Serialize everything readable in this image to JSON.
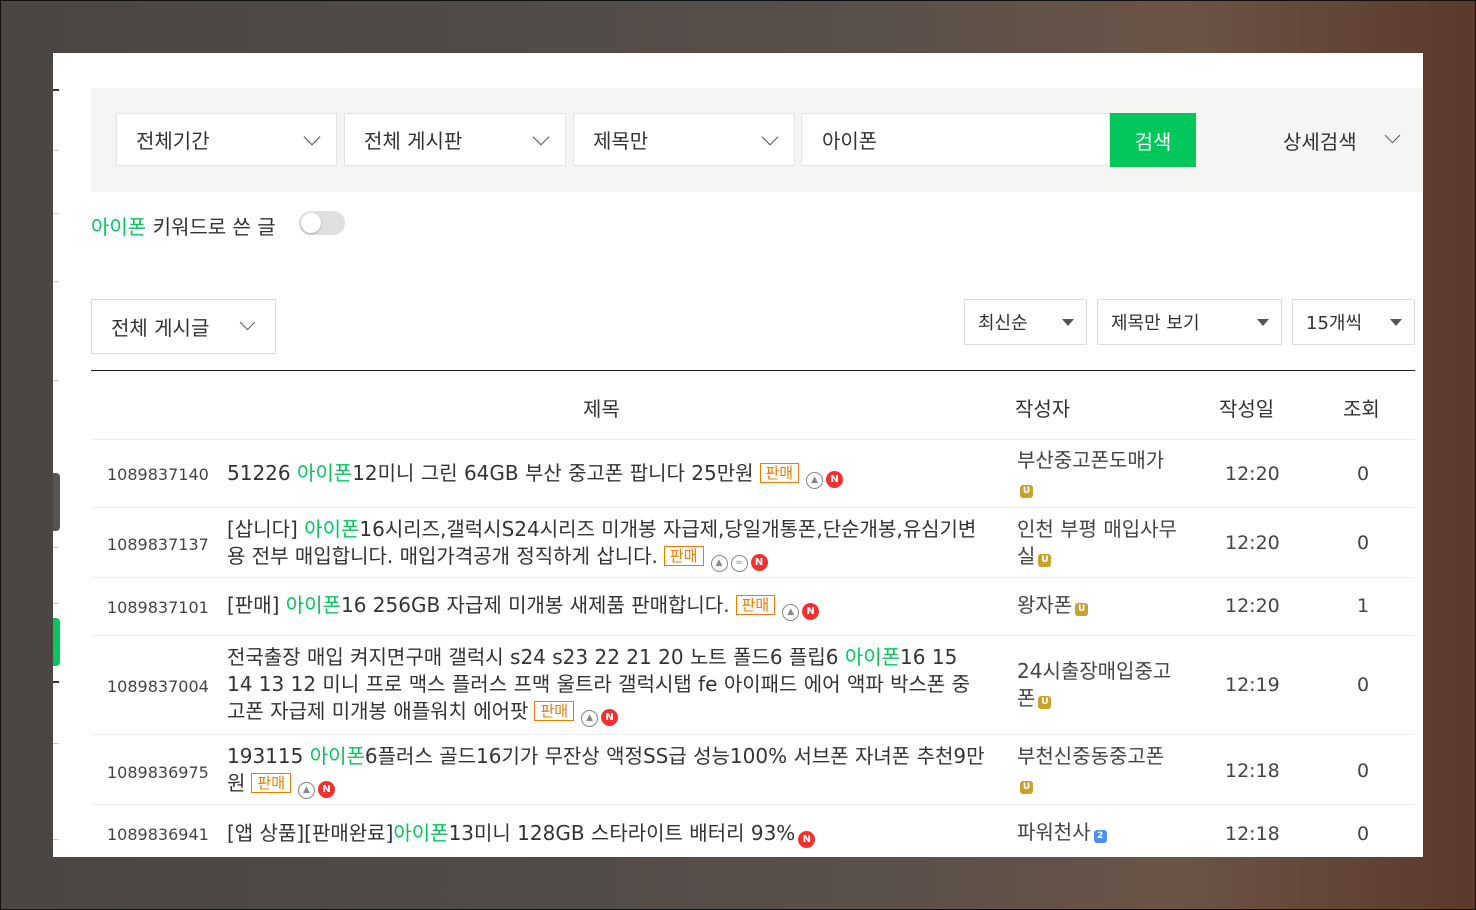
{
  "search": {
    "period": "전체기간",
    "board": "전체 게시판",
    "scope": "제목만",
    "query": "아이폰",
    "button": "검색",
    "advanced": "상세검색"
  },
  "keyword_toggle": {
    "keyword": "아이폰",
    "label": "키워드로 쓴 글",
    "on": false
  },
  "filters": {
    "all_posts": "전체 게시글",
    "sort": "최신순",
    "view": "제목만 보기",
    "per_page": "15개씩"
  },
  "table": {
    "headers": {
      "title": "제목",
      "author": "작성자",
      "date": "작성일",
      "views": "조회"
    },
    "rows": [
      {
        "num": "1089837140",
        "pre": "51226 ",
        "kw": "아이폰",
        "post": "12미니 그린 64GB 부산 중고폰 팝니다 25만원",
        "badge": "판매",
        "icons": [
          "image-icon",
          "new-icon"
        ],
        "author": "부산중고폰도매가",
        "level": "gold",
        "time": "12:20",
        "views": "0"
      },
      {
        "num": "1089837137",
        "pre": "[삽니다] ",
        "kw": "아이폰",
        "post": "16시리즈,갤럭시S24시리즈 미개봉 자급제,당일개통폰,단순개봉,유심기변용 전부 매입합니다. 매입가격공개 정직하게 삽니다.",
        "badge": "판매",
        "icons": [
          "image-icon",
          "link-icon",
          "new-icon"
        ],
        "author": "인천 부평 매입사무실",
        "level": "gold",
        "time": "12:20",
        "views": "0"
      },
      {
        "num": "1089837101",
        "pre": "[판매] ",
        "kw": "아이폰",
        "post": "16 256GB 자급제 미개봉 새제품 판매합니다.",
        "badge": "판매",
        "icons": [
          "image-icon",
          "new-icon"
        ],
        "author": "왕자폰",
        "level": "gold",
        "time": "12:20",
        "views": "1"
      },
      {
        "num": "1089837004",
        "pre": "전국출장 매입 켜지면구매 갤럭시 s24 s23 22 21 20 노트 폴드6 플립6 ",
        "kw": "아이폰",
        "post": "16 15 14 13 12 미니 프로 맥스 플러스 프맥 울트라 갤럭시탭 fe 아이패드 에어 액파 박스폰 중고폰 자급제 미개봉 애플워치 에어팟",
        "badge": "판매",
        "icons": [
          "image-icon",
          "new-icon"
        ],
        "author": "24시출장매입중고폰",
        "level": "gold",
        "time": "12:19",
        "views": "0"
      },
      {
        "num": "1089836975",
        "pre": "193115 ",
        "kw": "아이폰",
        "post": "6플러스 골드16기가 무잔상 액정SS급 성능100% 서브폰 자녀폰 추천9만원",
        "badge": "판매",
        "icons": [
          "image-icon",
          "new-icon"
        ],
        "author": "부천신중동중고폰",
        "level": "gold",
        "time": "12:18",
        "views": "0"
      },
      {
        "num": "1089836941",
        "pre": "[앱 상품][판매완료]",
        "kw": "아이폰",
        "post": "13미니 128GB 스타라이트 배터리 93%",
        "badge": "",
        "icons": [
          "new-icon"
        ],
        "author": "파워천사",
        "level": "blue",
        "time": "12:18",
        "views": "0"
      }
    ]
  },
  "colors": {
    "accent": "#03c75a",
    "badge": "#f07b00",
    "new": "#f23030",
    "level_gold": "#c8a22b",
    "level_blue": "#4f8ef7"
  }
}
